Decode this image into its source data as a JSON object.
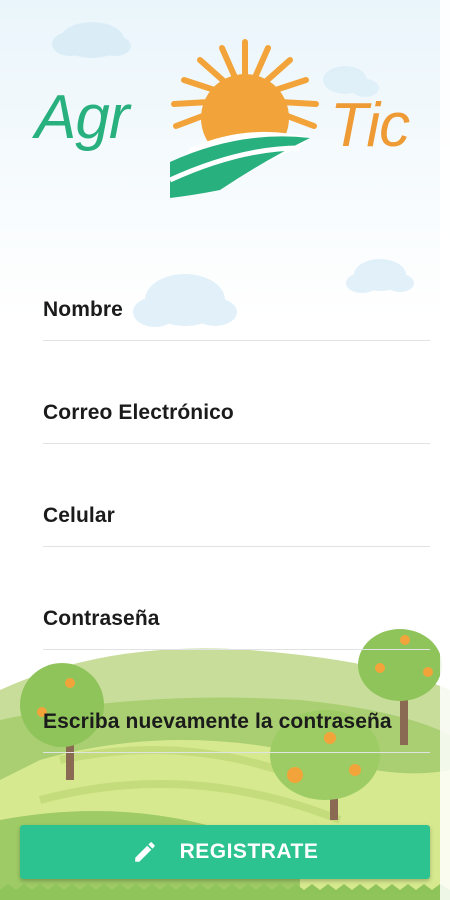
{
  "logo": {
    "left_text": "Agr",
    "right_text": "Tic",
    "colors": {
      "green": "#28b07f",
      "orange": "#ee9a35",
      "sun": "#f2a43a"
    }
  },
  "form": {
    "fields": [
      {
        "name": "nombre",
        "label": "Nombre"
      },
      {
        "name": "correo",
        "label": "Correo Electrónico"
      },
      {
        "name": "celular",
        "label": "Celular"
      },
      {
        "name": "contrasena",
        "label": "Contraseña"
      },
      {
        "name": "confirmar",
        "label": "Escriba nuevamente la contraseña"
      }
    ]
  },
  "register_button": {
    "label": "REGISTRATE",
    "icon": "pencil-icon",
    "color": "#2cc391"
  }
}
